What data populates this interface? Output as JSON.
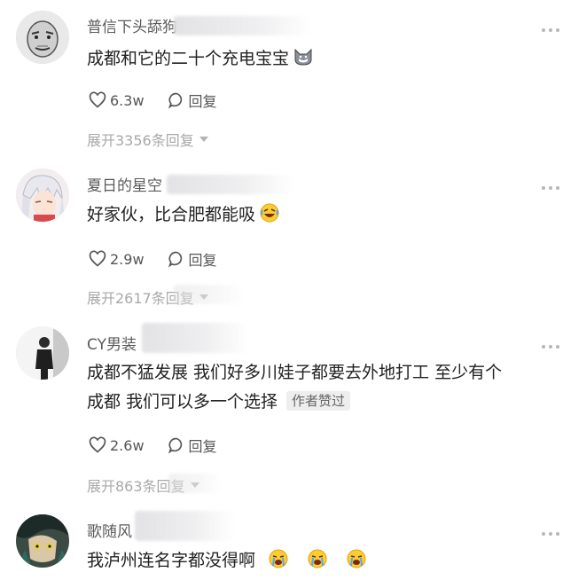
{
  "comments": [
    {
      "username": "普信下头舔狗",
      "content": "成都和它的二十个充电宝宝",
      "emoji": "wolf-emoji",
      "likes": "6.3w",
      "reply_label": "回复",
      "expand_label": "展开3356条回复"
    },
    {
      "username": "夏日的星空",
      "content": "好家伙，比合肥都能吸",
      "emoji": "rofl-emoji",
      "likes": "2.9w",
      "reply_label": "回复",
      "expand_label": "展开2617条回复"
    },
    {
      "username": "CY男装",
      "content_line1": "成都不猛发展 我们好多川娃子都要去外地打工 至少有个",
      "content_line2": "成都 我们可以多一个选择",
      "badge": "作者赞过",
      "likes": "2.6w",
      "reply_label": "回复",
      "expand_label": "展开863条回复"
    },
    {
      "username": "歌随风",
      "content": "我泸州连名字都没得啊",
      "emoji": "crying-emoji"
    }
  ],
  "colors": {
    "username": "#5b5b5b",
    "content": "#222222",
    "secondary": "#a8a8a8",
    "badge_bg": "#eeeeee"
  }
}
